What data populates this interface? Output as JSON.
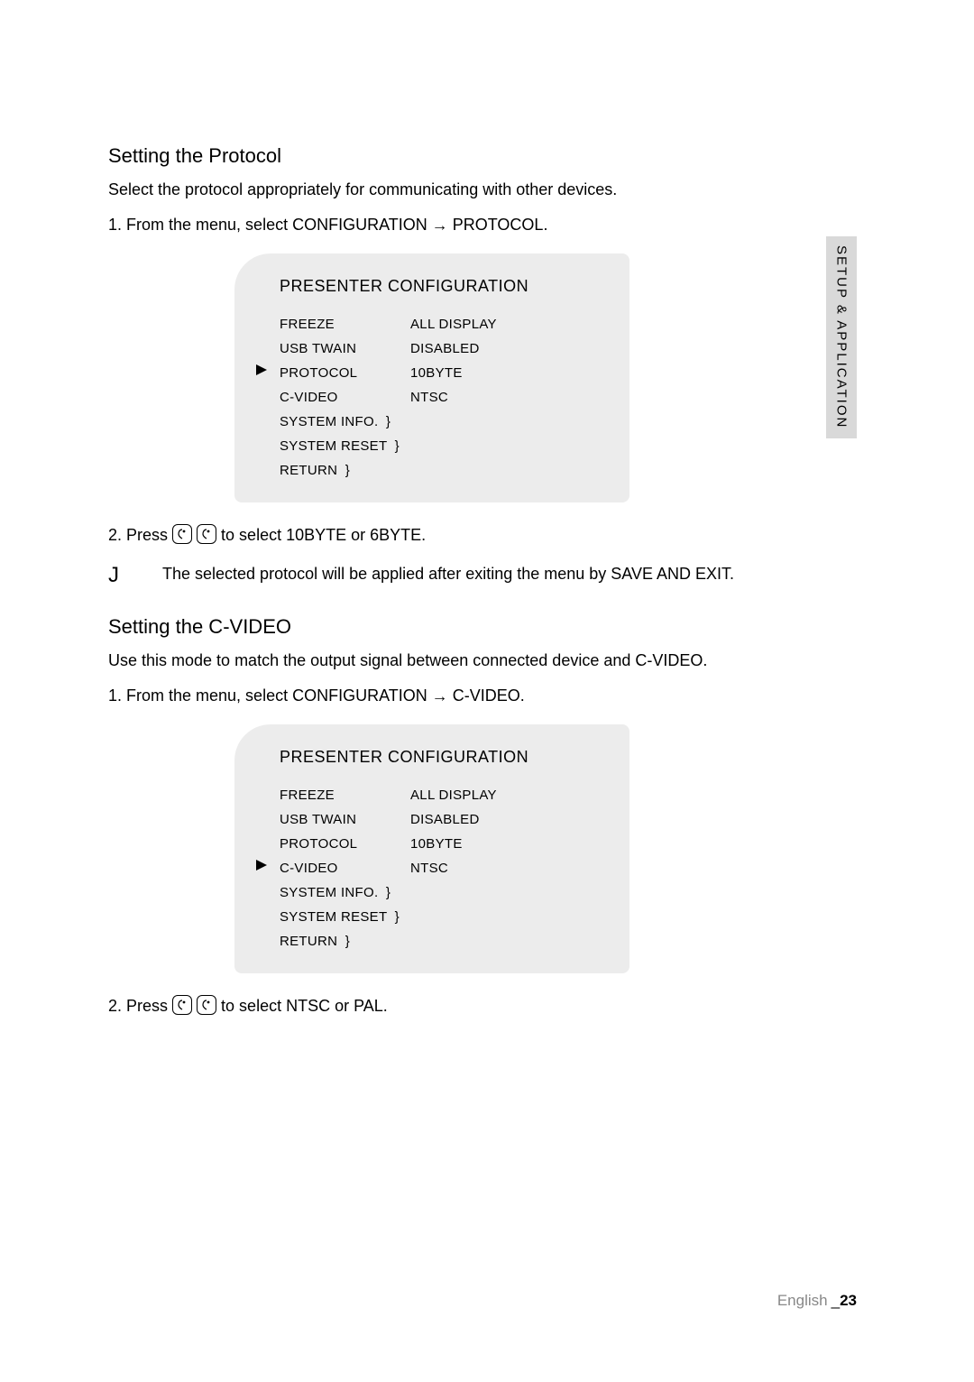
{
  "sidebar_tab": "SETUP & APPLICATION",
  "protocol": {
    "heading": "Setting the Protocol",
    "intro": "Select the protocol appropriately for communicating with other devices.",
    "step1_pre": "1.  From the menu, select CONFIGURATION ",
    "step1_post": " PROTOCOL.",
    "step2_pre": "2.  Press ",
    "step2_post": " to select 10BYTE or 6BYTE."
  },
  "cvideo": {
    "heading": "Setting the C-VIDEO",
    "intro": "Use this mode to match the output signal between connected device and C-VIDEO.",
    "step1_pre": "1.  From the menu, select CONFIGURATION ",
    "step1_post": " C-VIDEO.",
    "step2_pre": "2.  Press ",
    "step2_post": " to select NTSC or PAL."
  },
  "note_j": "J",
  "note_text": "The selected protocol will be applied after exiting the menu by SAVE AND EXIT.",
  "menu1": {
    "title": "PRESENTER CONFIGURATION",
    "rows": [
      {
        "label": "FREEZE",
        "value": "ALL DISPLAY",
        "selected": false
      },
      {
        "label": "USB TWAIN",
        "value": "DISABLED",
        "selected": false
      },
      {
        "label": "PROTOCOL",
        "value": "10BYTE",
        "selected": true
      },
      {
        "label": "C-VIDEO",
        "value": "NTSC",
        "selected": false
      },
      {
        "label": "SYSTEM INFO.",
        "value": "",
        "brace": true,
        "selected": false
      },
      {
        "label": "SYSTEM RESET",
        "value": "",
        "brace": true,
        "selected": false
      },
      {
        "label": "RETURN",
        "value": "",
        "brace": true,
        "selected": false
      }
    ]
  },
  "menu2": {
    "title": "PRESENTER CONFIGURATION",
    "rows": [
      {
        "label": "FREEZE",
        "value": "ALL DISPLAY",
        "selected": false
      },
      {
        "label": "USB TWAIN",
        "value": "DISABLED",
        "selected": false
      },
      {
        "label": "PROTOCOL",
        "value": "10BYTE",
        "selected": false
      },
      {
        "label": "C-VIDEO",
        "value": "NTSC",
        "selected": true
      },
      {
        "label": "SYSTEM INFO.",
        "value": "",
        "brace": true,
        "selected": false
      },
      {
        "label": "SYSTEM RESET",
        "value": "",
        "brace": true,
        "selected": false
      },
      {
        "label": "RETURN",
        "value": "",
        "brace": true,
        "selected": false
      }
    ]
  },
  "footer": {
    "lang": "English",
    "sep": "_",
    "page": "23"
  }
}
